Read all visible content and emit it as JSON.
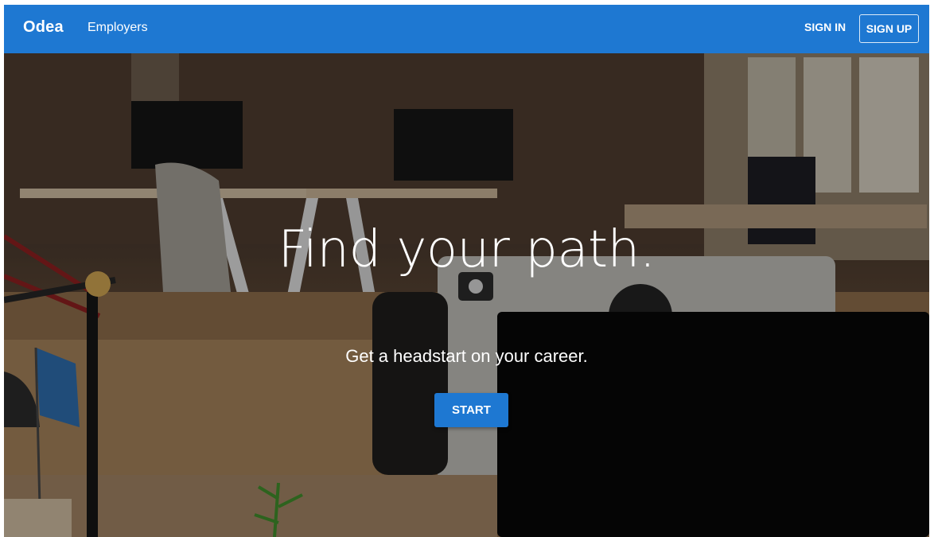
{
  "nav": {
    "brand": "Odea",
    "employers": "Employers",
    "sign_in": "SIGN IN",
    "sign_up": "SIGN UP"
  },
  "hero": {
    "title": "Find your path.",
    "subtitle": "Get a headstart on your career.",
    "cta": "START"
  },
  "colors": {
    "accent": "#1e78d2"
  }
}
